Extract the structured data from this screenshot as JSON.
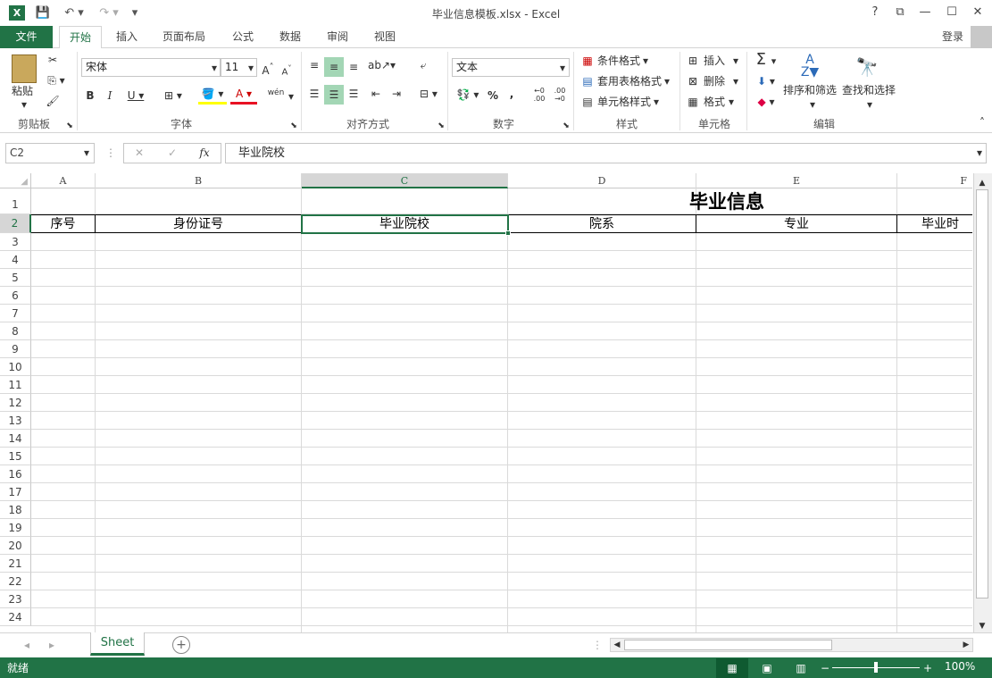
{
  "window": {
    "title": "毕业信息模板.xlsx - Excel",
    "help": "?",
    "login": "登录"
  },
  "tabs": [
    "文件",
    "开始",
    "插入",
    "页面布局",
    "公式",
    "数据",
    "审阅",
    "视图"
  ],
  "ribbon": {
    "clipboard": {
      "label": "剪贴板",
      "paste": "粘贴"
    },
    "font": {
      "label": "字体",
      "name": "宋体",
      "size": "11",
      "wen": "wén"
    },
    "alignment": {
      "label": "对齐方式"
    },
    "number": {
      "label": "数字",
      "format": "文本"
    },
    "styles": {
      "label": "样式",
      "conditional": "条件格式",
      "table": "套用表格格式",
      "cell": "单元格样式"
    },
    "cells": {
      "label": "单元格",
      "insert": "插入",
      "delete": "删除",
      "format": "格式"
    },
    "editing": {
      "label": "编辑",
      "sort": "排序和筛选",
      "find": "查找和选择"
    }
  },
  "formula_bar": {
    "name_box": "C2",
    "fx": "fx",
    "value": "毕业院校"
  },
  "columns": [
    "A",
    "B",
    "C",
    "D",
    "E",
    "F"
  ],
  "rows": [
    "1",
    "2",
    "3",
    "4",
    "5",
    "6",
    "7",
    "8",
    "9",
    "10",
    "11",
    "12",
    "13",
    "14",
    "15",
    "16",
    "17",
    "18",
    "19",
    "20",
    "21",
    "22",
    "23",
    "24"
  ],
  "sheet": {
    "title": "毕业信息",
    "headers": [
      "序号",
      "身份证号",
      "毕业院校",
      "院系",
      "专业",
      "毕业时"
    ]
  },
  "sheet_tabs": [
    "Sheet"
  ],
  "status": {
    "ready": "就绪",
    "zoom": "100%"
  },
  "colors": {
    "accent": "#217346",
    "selected_header": "#d6d6d6"
  }
}
